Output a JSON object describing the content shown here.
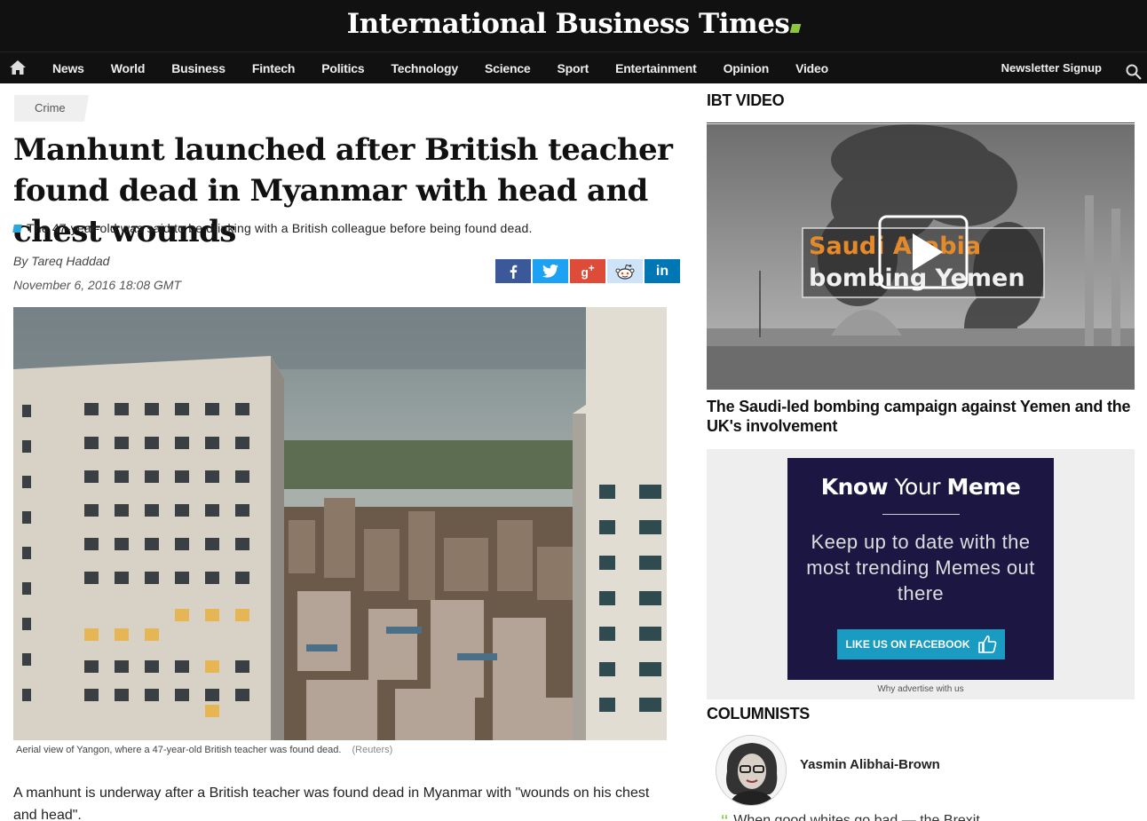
{
  "site": {
    "logo_text": "International Business Times",
    "accent_color": "#8cc63f"
  },
  "nav": {
    "home_icon": "home-icon",
    "items": [
      "News",
      "World",
      "Business",
      "Fintech",
      "Politics",
      "Technology",
      "Science",
      "Sport",
      "Entertainment",
      "Opinion",
      "Video"
    ],
    "newsletter": "Newsletter Signup",
    "search_icon": "search-icon"
  },
  "article": {
    "category": "Crime",
    "headline": "Manhunt launched after British teacher found dead in Myanmar with head and chest wounds",
    "standfirst": "The 47-year-old was said to be drinking with a British colleague before being found dead.",
    "byline": "By Tareq Haddad",
    "date": "November 6, 2016 18:08 GMT",
    "share": [
      {
        "label": "f",
        "icon": "facebook-icon",
        "color": "#3b5998"
      },
      {
        "label": "t",
        "icon": "twitter-icon",
        "color": "#1da1f2"
      },
      {
        "label": "g+",
        "icon": "google-plus-icon",
        "color": "#dd4b39"
      },
      {
        "label": "reddit",
        "icon": "reddit-icon",
        "color": "#cee3f8"
      },
      {
        "label": "in",
        "icon": "linkedin-icon",
        "color": "#0077b5"
      }
    ],
    "caption": "Aerial view of Yangon, where a 47-year-old British teacher was found dead.",
    "caption_credit": "(Reuters)",
    "body_first": "A manhunt is underway after a British teacher was found dead in Myanmar with \"wounds on his chest and head\"."
  },
  "sidebar": {
    "video_section_title": "IBT VIDEO",
    "video_overlay_line1": "Saudi Arabia",
    "video_overlay_line2": "bombing Yemen",
    "video_headline": "The Saudi-led bombing campaign against Yemen and the UK's involvement",
    "ad": {
      "title_bold1": "Know",
      "title_light": "Your",
      "title_bold2": "Meme",
      "text": "Keep up to date with the most trending Memes out there",
      "button": "LIKE US ON FACEBOOK",
      "why": "Why advertise with us"
    },
    "columnists_title": "COLUMNISTS",
    "columnist_name": "Yasmin Alibhai-Brown",
    "columnist_quote": "When good whites go bad — the Brexit ..."
  }
}
